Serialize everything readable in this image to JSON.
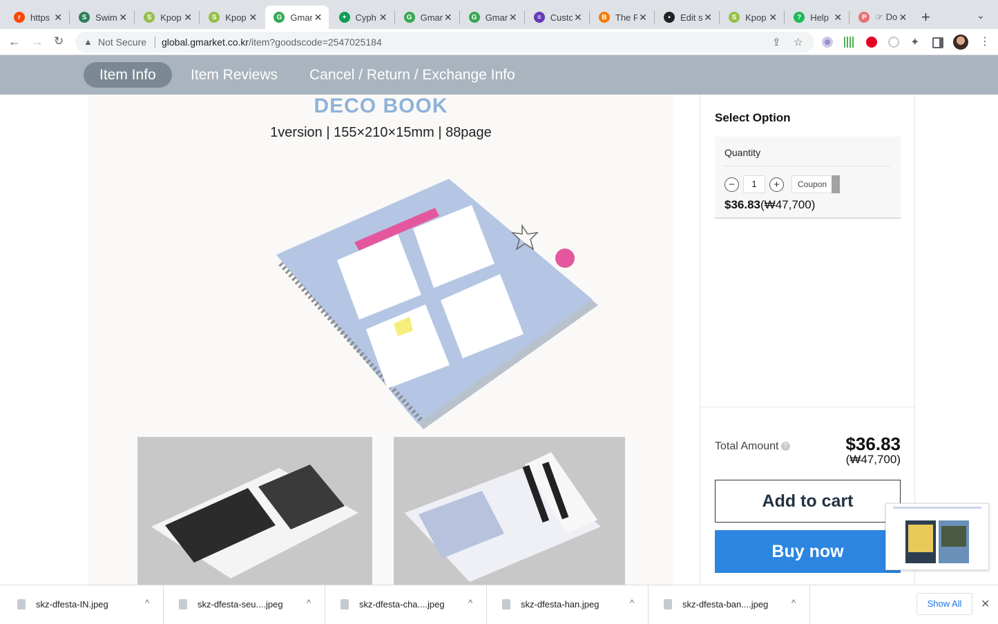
{
  "browser": {
    "tabs": [
      {
        "title": "https",
        "icon": "reddit-icon",
        "color": "#ff4500",
        "glyph": "r"
      },
      {
        "title": "Swim",
        "icon": "swim-icon",
        "color": "#2e7d5b",
        "glyph": "S"
      },
      {
        "title": "Kpop",
        "icon": "shopify-icon",
        "color": "#95bf47",
        "glyph": "S"
      },
      {
        "title": "Kpop",
        "icon": "shopify-icon",
        "color": "#95bf47",
        "glyph": "S"
      },
      {
        "title": "Gmar",
        "icon": "google-icon",
        "color": "#34a853",
        "glyph": "G"
      },
      {
        "title": "Cyph",
        "icon": "sheets-icon",
        "color": "#0f9d58",
        "glyph": "+"
      },
      {
        "title": "Gmar",
        "icon": "google-icon",
        "color": "#34a853",
        "glyph": "G"
      },
      {
        "title": "Gmar",
        "icon": "google-icon",
        "color": "#34a853",
        "glyph": "G"
      },
      {
        "title": "Custo",
        "icon": "forms-icon",
        "color": "#673ab7",
        "glyph": "≡"
      },
      {
        "title": "The F",
        "icon": "blogger-icon",
        "color": "#f57c00",
        "glyph": "B"
      },
      {
        "title": "Edit s",
        "icon": "edit-icon",
        "color": "#202124",
        "glyph": "▪"
      },
      {
        "title": "Kpop",
        "icon": "shopify-icon",
        "color": "#95bf47",
        "glyph": "S"
      },
      {
        "title": "Help",
        "icon": "help-icon",
        "color": "#1db954",
        "glyph": "?"
      },
      {
        "title": "☞ Do",
        "icon": "docs-icon",
        "color": "#e57373",
        "glyph": "P"
      }
    ],
    "active_tab": 4,
    "security_label": "Not Secure",
    "url_host": "global.gmarket.co.kr",
    "url_path": "/item?goodscode=2547025184"
  },
  "pagenav": {
    "items": [
      "Item Info",
      "Item Reviews",
      "Cancel / Return / Exchange Info"
    ]
  },
  "product": {
    "title": "DECO BOOK",
    "subtitle": "1version | 155×210×15mm | 88page"
  },
  "option": {
    "title": "Select Option",
    "quantity_label": "Quantity",
    "quantity": "1",
    "coupon_label": "Coupon",
    "price_usd": "$36.83",
    "price_krw": "(₩47,700)"
  },
  "summary": {
    "total_label": "Total Amount",
    "total_usd": "$36.83",
    "total_krw": "(₩47,700)",
    "add_to_cart": "Add to cart",
    "buy_now": "Buy now"
  },
  "downloads": {
    "files": [
      "skz-dfesta-IN.jpeg",
      "skz-dfesta-seu....jpeg",
      "skz-dfesta-cha....jpeg",
      "skz-dfesta-han.jpeg",
      "skz-dfesta-ban....jpeg"
    ],
    "show_all": "Show All"
  }
}
